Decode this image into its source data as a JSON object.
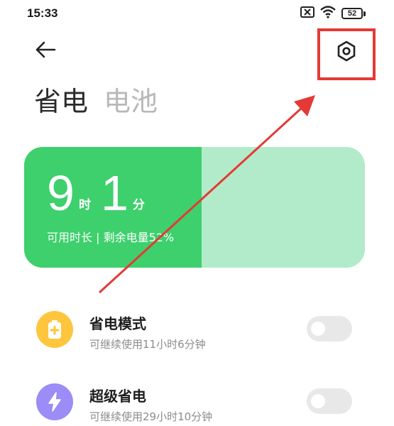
{
  "status_bar": {
    "time": "15:33",
    "battery_level": "52"
  },
  "header": {
    "back_icon": "arrow-left-icon",
    "settings_icon": "hexagon-settings-icon"
  },
  "tabs": [
    {
      "label": "省电",
      "active": true
    },
    {
      "label": "电池",
      "active": false
    }
  ],
  "battery_card": {
    "hours": "9",
    "hours_unit": "时",
    "minutes": "1",
    "minutes_unit": "分",
    "info": "可用时长 | 剩余电量52%",
    "level_fraction": 0.52
  },
  "modes": [
    {
      "title": "省电模式",
      "subtitle": "可继续使用11小时6分钟",
      "icon": "battery-saver-icon",
      "icon_color": "#ffc53d",
      "enabled": false
    },
    {
      "title": "超级省电",
      "subtitle": "可继续使用29小时10分钟",
      "icon": "lightning-icon",
      "icon_color": "#9b8cf7",
      "enabled": false
    }
  ],
  "colors": {
    "accent_green": "#3dd06c",
    "light_green": "#b2ebc9",
    "highlight_red": "#e53935"
  }
}
